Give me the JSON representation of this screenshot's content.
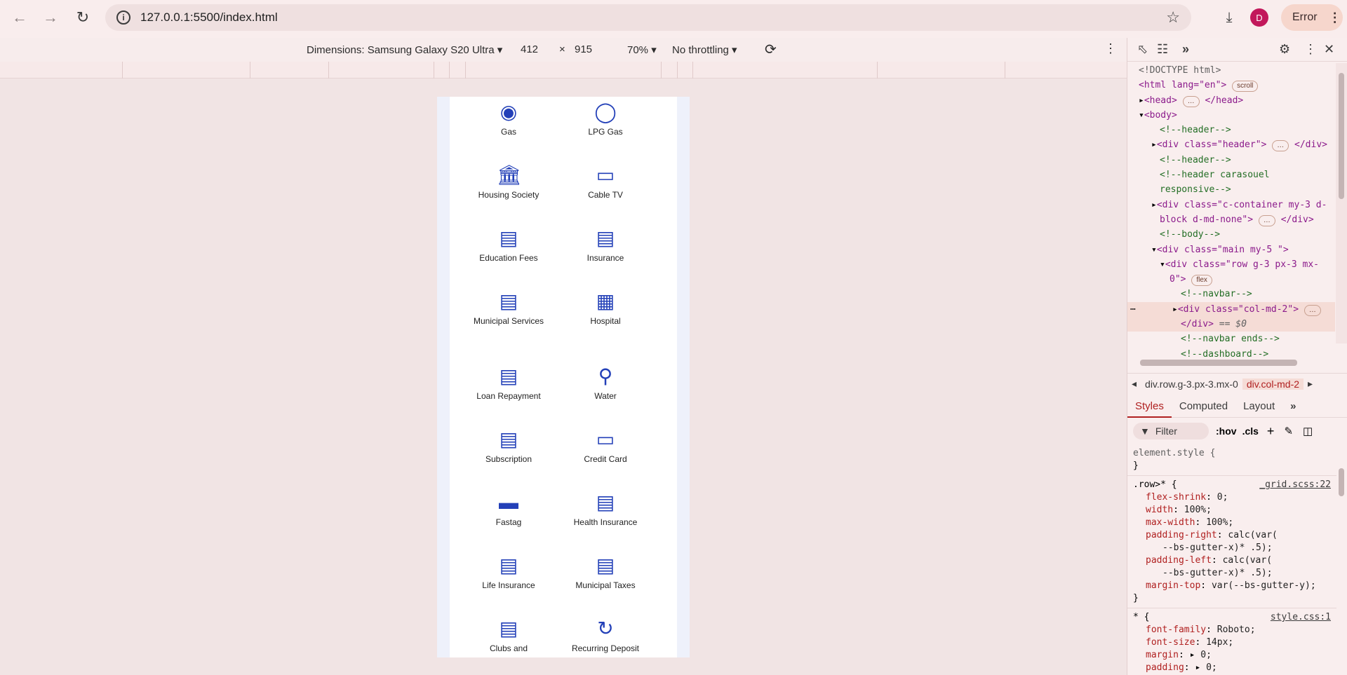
{
  "browser": {
    "url": "127.0.0.1:5500/index.html",
    "avatar_letter": "D",
    "error_label": "Error"
  },
  "device_toolbar": {
    "dimensions_label": "Dimensions: Samsung Galaxy S20 Ultra",
    "width": "412",
    "times": "×",
    "height": "915",
    "zoom": "70%",
    "throttling": "No throttling"
  },
  "services": [
    {
      "label": "Gas",
      "icon": "gas-meter-icon"
    },
    {
      "label": "LPG Gas",
      "icon": "lpg-cylinder-icon"
    },
    {
      "label": "Housing Society",
      "icon": "building-icon"
    },
    {
      "label": "Cable TV",
      "icon": "cable-tv-icon"
    },
    {
      "label": "Education Fees",
      "icon": "education-fees-icon"
    },
    {
      "label": "Insurance",
      "icon": "insurance-icon"
    },
    {
      "label": "Municipal Services",
      "icon": "municipal-document-icon"
    },
    {
      "label": "Hospital",
      "icon": "hospital-icon"
    },
    {
      "label": "Loan Repayment",
      "icon": "loan-emi-icon"
    },
    {
      "label": "Water",
      "icon": "water-tap-icon"
    },
    {
      "label": "Subscription",
      "icon": "subscription-icon"
    },
    {
      "label": "Credit Card",
      "icon": "credit-card-icon"
    },
    {
      "label": "Fastag",
      "icon": "fastag-logo-icon"
    },
    {
      "label": "Health Insurance",
      "icon": "health-insurance-icon"
    },
    {
      "label": "Life Insurance",
      "icon": "life-insurance-icon"
    },
    {
      "label": "Municipal Taxes",
      "icon": "municipal-taxes-icon"
    },
    {
      "label": "Clubs and",
      "icon": "clubs-icon"
    },
    {
      "label": "Recurring Deposit",
      "icon": "recurring-deposit-icon"
    }
  ],
  "devtools": {
    "elements": {
      "doctype": "<!DOCTYPE html>",
      "html_open": "<html lang=\"en\">",
      "scroll_badge": "scroll",
      "head": "<head>",
      "head_close": "</head>",
      "body": "<body>",
      "c_header": "<!--header-->",
      "div_header": "<div class=\"header\">",
      "div_close": "</div>",
      "c_header2": "<!--header-->",
      "c_carousel_1": "<!--header carasouel",
      "c_carousel_2": "responsive-->",
      "div_container_1": "<div class=\"c-container my-3 d-",
      "div_container_2": "block d-md-none\">",
      "c_body": "<!--body-->",
      "div_main": "<div class=\"main my-5 \">",
      "div_row_1": "<div class=\"row g-3 px-3 mx-",
      "div_row_2": "0\">",
      "flex_badge": "flex",
      "c_navbar": "<!--navbar-->",
      "div_col": "<div class=\"col-md-2\">",
      "div_col_close": "</div>",
      "dollar0": "== $0",
      "c_navbar_end": "<!--navbar ends-->",
      "c_dashboard": "<!--dashboard-->",
      "ellipsis": "…"
    },
    "breadcrumbs": [
      "div.row.g-3.px-3.mx-0",
      "div.col-md-2"
    ],
    "tabs": [
      "Styles",
      "Computed",
      "Layout"
    ],
    "filter_placeholder": "Filter",
    "hov": ":hov",
    "cls": ".cls",
    "styles": {
      "element_style": "element.style {",
      "close": "}",
      "row_selector": ".row>* {",
      "row_src": "_grid.scss:22",
      "p1": "flex-shrink",
      "v1": "0;",
      "p2": "width",
      "v2": "100%;",
      "p3": "max-width",
      "v3": "100%;",
      "p4": "padding-right",
      "v4a": "calc(var(",
      "v4b": "--bs-gutter-x)* .5);",
      "p5": "padding-left",
      "v5a": "calc(var(",
      "v5b": "--bs-gutter-x)* .5);",
      "p6": "margin-top",
      "v6": "var(--bs-gutter-y);",
      "star_selector": "* {",
      "star_src": "style.css:1",
      "p7": "font-family",
      "v7": "Roboto;",
      "p8": "font-size",
      "v8": "14px;",
      "p9": "margin",
      "v9": "0;",
      "p10": "padding",
      "v10": "0;"
    }
  }
}
